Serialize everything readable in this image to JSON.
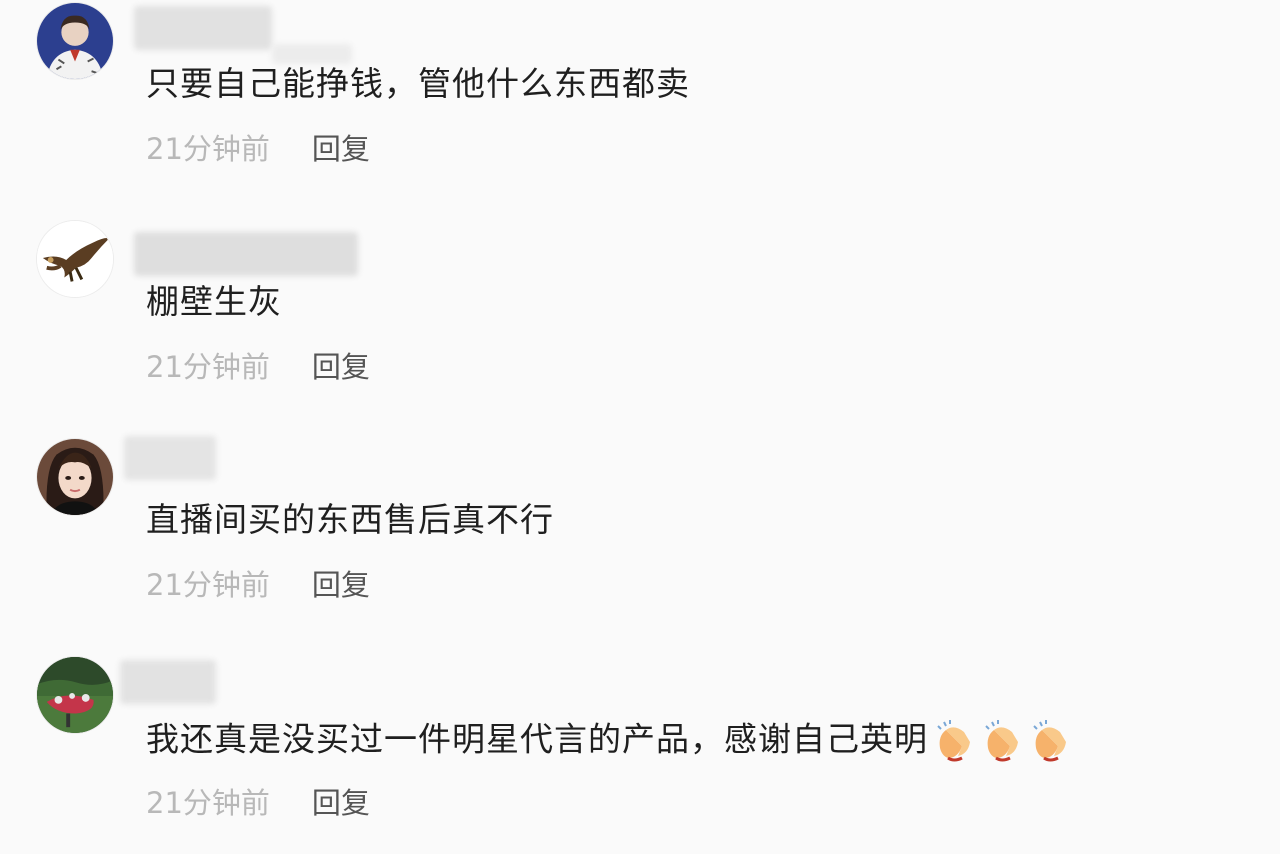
{
  "comments": [
    {
      "avatar_icon": "avatar-woman-portrait-icon",
      "text": "只要自己能挣钱，管他什么东西都卖",
      "time": "21分钟前",
      "reply_label": "回复"
    },
    {
      "avatar_icon": "avatar-eagle-icon",
      "text": "棚壁生灰",
      "time": "21分钟前",
      "reply_label": "回复"
    },
    {
      "avatar_icon": "avatar-girl-photo-icon",
      "text": "直播间买的东西售后真不行",
      "time": "21分钟前",
      "reply_label": "回复"
    },
    {
      "avatar_icon": "avatar-garden-photo-icon",
      "text": "我还真是没买过一件明星代言的产品，感谢自己英明",
      "emoji": [
        "clapping-hands-icon",
        "clapping-hands-icon",
        "clapping-hands-icon"
      ],
      "time": "21分钟前",
      "reply_label": "回复"
    }
  ]
}
